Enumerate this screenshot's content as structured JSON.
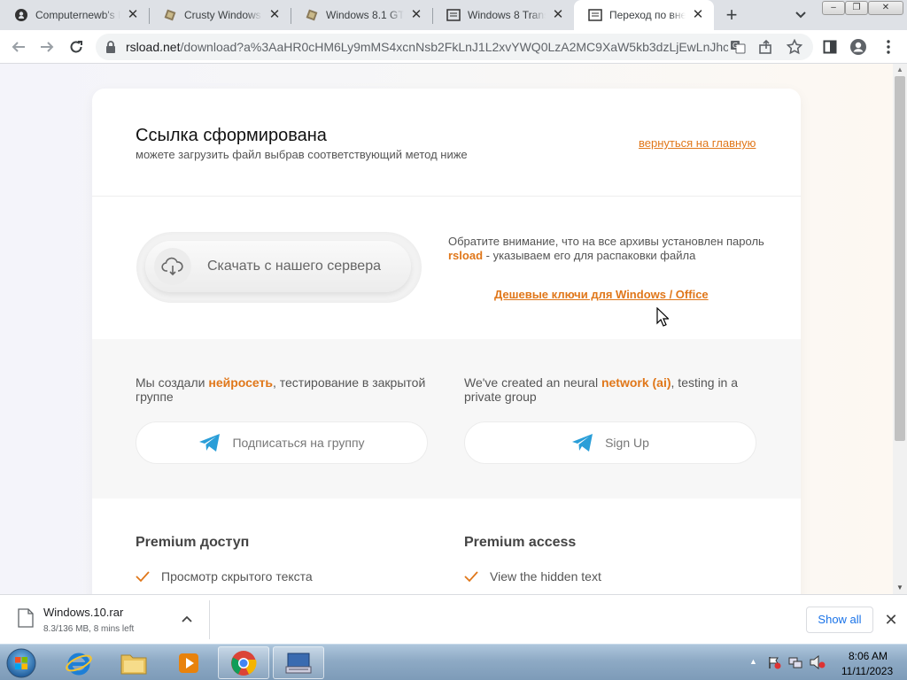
{
  "browser": {
    "tabs": [
      {
        "title": "Computernewb's I",
        "icon": "github-icon",
        "active": false
      },
      {
        "title": "Crusty Windows V",
        "icon": "archive-icon",
        "active": false
      },
      {
        "title": "Windows 8.1 GTA",
        "icon": "archive-icon",
        "active": false
      },
      {
        "title": "Windows 8 Transf",
        "icon": "page-icon",
        "active": false
      },
      {
        "title": "Переход по внеш",
        "icon": "page-icon",
        "active": true
      }
    ],
    "new_tab": "+",
    "window_controls": {
      "minimize": "–",
      "restore": "❐",
      "close": "✕"
    },
    "url_host": "rsload.net",
    "url_path": "/download?a%3AaHR0cHM6Ly9mMS4xcnNsb2FkLnJ1L2xvYWQ0LzA2MC9XaW5kb3dzLjEwLnJhcg..."
  },
  "page": {
    "title": "Ссылка сформирована",
    "subtitle": "можете загрузить файл выбрав соответствующий метод ниже",
    "back_link": "вернуться на главную",
    "download_button": "Скачать с нашего сервера",
    "notice_part1": "Обратите внимание, что на все архивы установлен пароль ",
    "notice_password": "rsload",
    "notice_part2": " - указываем его для распаковки файла",
    "keys_link": "Дешевые ключи для Windows / Office",
    "ai_ru_part1": "Мы создали ",
    "ai_ru_highlight": "нейросеть",
    "ai_ru_part2": ", тестирование в закрытой группе",
    "ai_en_part1": "We've created an neural ",
    "ai_en_highlight": "network (ai)",
    "ai_en_part2": ", testing in a private group",
    "subscribe_ru": "Подписаться на группу",
    "subscribe_en": "Sign Up",
    "premium_ru_title": "Premium доступ",
    "premium_en_title": "Premium access",
    "premium_ru_item": "Просмотр скрытого текста",
    "premium_en_item": "View the hidden text",
    "accent_color": "#e0771a"
  },
  "download_shelf": {
    "filename": "Windows.10.rar",
    "status": "8.3/136 MB, 8 mins left",
    "show_all": "Show all"
  },
  "taskbar": {
    "apps": [
      "start-orb",
      "internet-explorer",
      "file-explorer",
      "media-player",
      "chrome",
      "keyboard-app"
    ],
    "clock_time": "8:06 AM",
    "clock_date": "11/11/2023"
  }
}
